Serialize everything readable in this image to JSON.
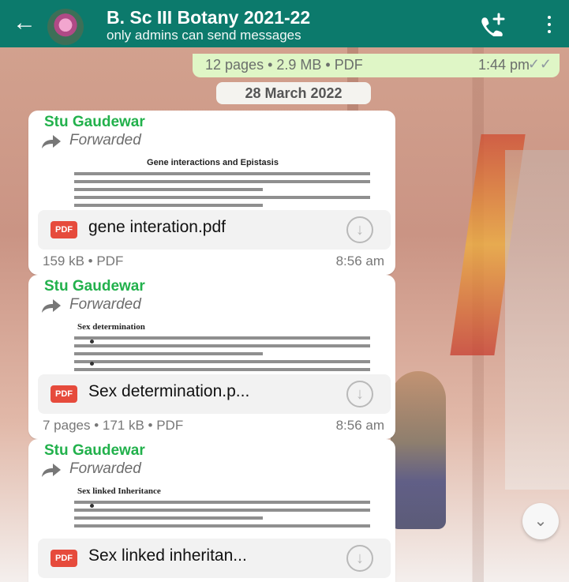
{
  "header": {
    "back_icon": "arrow-left-icon",
    "title": "B. Sc III Botany 2021-22",
    "subtitle": "only admins can send messages",
    "call_icon": "add-call-icon",
    "menu_icon": "more-vertical-icon"
  },
  "top_message": {
    "info": "12 pages • 2.9 MB • PDF",
    "time": "1:44 pm",
    "ticks": "✓✓"
  },
  "date_separator": "28 March 2022",
  "messages": [
    {
      "sender": "Stu Gaudewar",
      "forwarded": "Forwarded",
      "preview_title": "Gene interactions and Epistasis",
      "file_name": "gene interation.pdf",
      "meta": "159 kB • PDF",
      "time": "8:56 am"
    },
    {
      "sender": "Stu Gaudewar",
      "forwarded": "Forwarded",
      "preview_title": "Sex determination",
      "file_name": "Sex determination.p...",
      "meta": "7 pages • 171 kB • PDF",
      "time": "8:56 am"
    },
    {
      "sender": "Stu Gaudewar",
      "forwarded": "Forwarded",
      "preview_title": "Sex linked Inheritance",
      "file_name": "Sex linked inheritan...",
      "meta": "",
      "time": ""
    }
  ],
  "pdf_badge": "PDF",
  "colors": {
    "header": "#0c7a6c",
    "sender": "#22b14c",
    "outgoing_bubble": "#dff6c6"
  }
}
